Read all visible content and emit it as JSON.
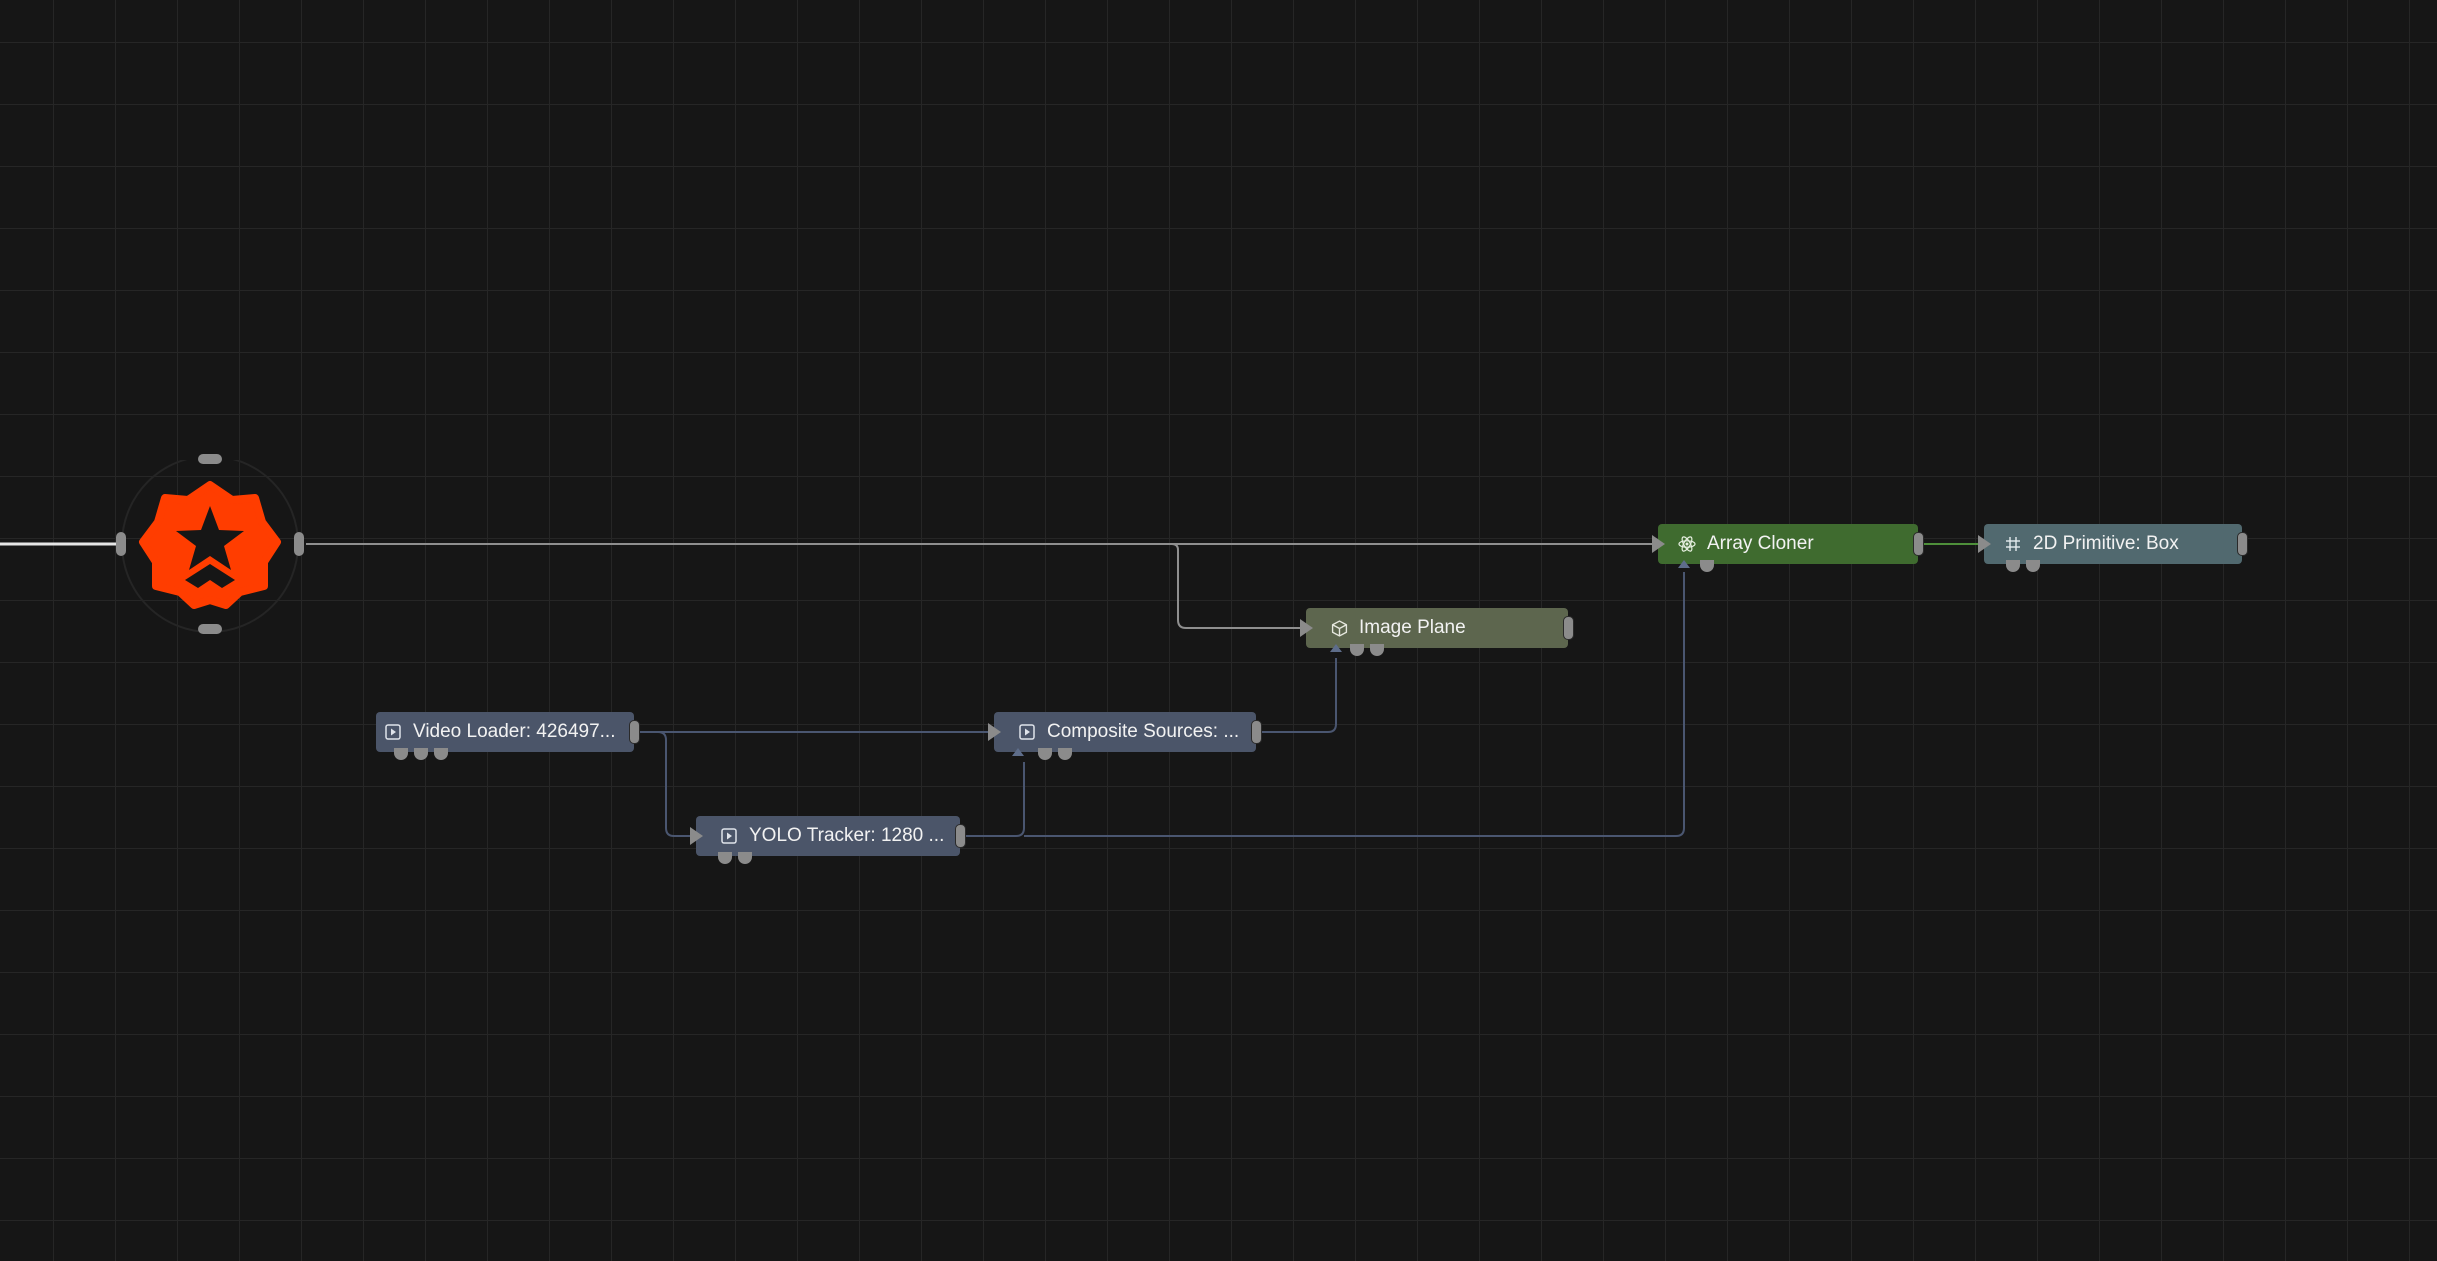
{
  "app": {
    "logo": {
      "icon": "brand-star-gear-icon",
      "color": "#ff3d00"
    }
  },
  "nodes": {
    "video_loader": {
      "label": "Video Loader: 426497...",
      "icon": "play-square-icon"
    },
    "yolo_tracker": {
      "label": "YOLO Tracker: 1280 ...",
      "icon": "play-square-icon"
    },
    "composite_sources": {
      "label": "Composite Sources: ...",
      "icon": "play-square-icon"
    },
    "image_plane": {
      "label": "Image Plane",
      "icon": "cube-icon"
    },
    "array_cloner": {
      "label": "Array Cloner",
      "icon": "atom-icon"
    },
    "primitive_box": {
      "label": "2D Primitive: Box",
      "icon": "hash-grid-icon"
    }
  },
  "colors": {
    "background": "#161616",
    "grid": "#262626",
    "media_node": "#4b5569",
    "plane_node": "#5d664e",
    "cloner_node": "#3f6b2f",
    "primitive_node": "#51696f",
    "port": "#8b8b8b",
    "wire_white": "#d9d9d9",
    "wire_blue": "#5e6d8a",
    "wire_green": "#4e8f3a"
  }
}
